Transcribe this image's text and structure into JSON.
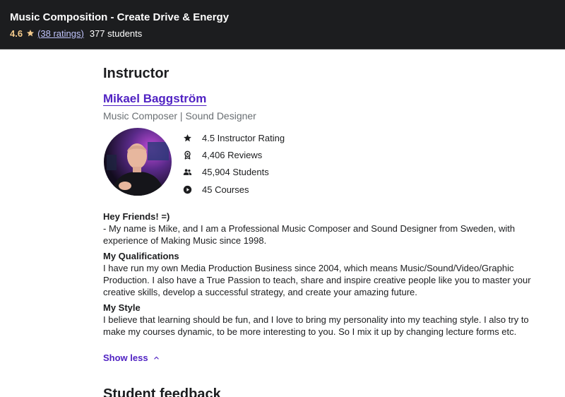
{
  "header": {
    "course_title": "Music Composition - Create Drive & Energy",
    "rating": "4.6",
    "ratings_link": "(38 ratings)",
    "students": "377 students",
    "rating_color": "#f3ca8c"
  },
  "instructor": {
    "section_title": "Instructor",
    "name": "Mikael Baggström",
    "job_title": "Music Composer | Sound Designer",
    "avatar_alt": "Mikael Baggström",
    "stats": [
      {
        "icon": "star-icon",
        "label": "4.5 Instructor Rating"
      },
      {
        "icon": "award-icon",
        "label": "4,406 Reviews"
      },
      {
        "icon": "people-icon",
        "label": "45,904 Students"
      },
      {
        "icon": "play-circle-icon",
        "label": "45 Courses"
      }
    ],
    "bio": {
      "greeting": "Hey Friends! =)",
      "intro": "- My name is Mike, and I am a Professional Music Composer and Sound Designer from Sweden, with experience of Making Music since 1998.",
      "qualifications_heading": "My Qualifications",
      "qualifications_text": "I have run my own Media Production Business since 2004, which means Music/Sound/Video/Graphic Production. I also have a True Passion to teach, share and inspire creative people like you to master your creative skills, develop a successful strategy, and create your amazing future.",
      "style_heading": "My Style",
      "style_text": "I believe that learning should be fun, and I love to bring my personality into my teaching style. I also try to make my courses dynamic, to be more interesting to you. So I mix it up by changing lecture forms etc."
    },
    "show_less": "Show less"
  },
  "next_section": {
    "title": "Student feedback"
  },
  "colors": {
    "topbar_bg": "#1c1d1f",
    "link_purple": "#5022c3",
    "text_dark": "#1c1d1f",
    "muted": "#6a6f73"
  }
}
